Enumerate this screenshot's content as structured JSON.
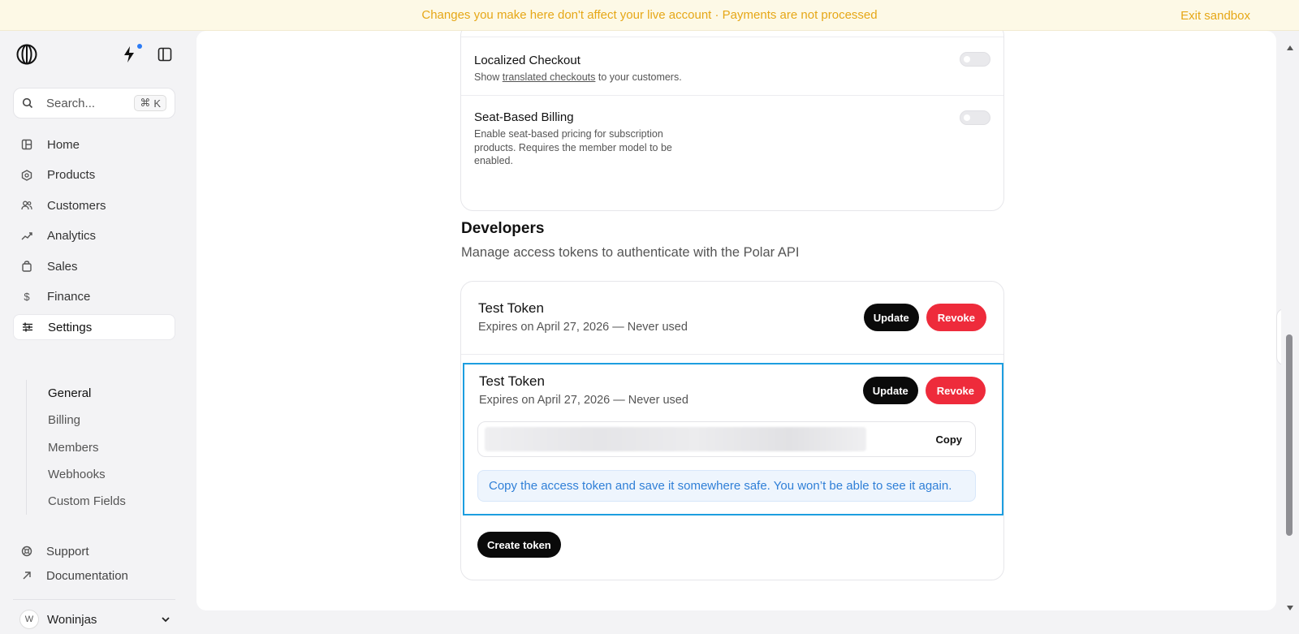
{
  "banner": {
    "message": "Changes you make here don't affect your live account · Payments are not processed",
    "exit_label": "Exit sandbox"
  },
  "sidebar": {
    "search": {
      "placeholder": "Search...",
      "shortcut_symbol": "⌘",
      "shortcut_key": "K"
    },
    "nav": [
      {
        "label": "Home",
        "icon": "home-icon"
      },
      {
        "label": "Products",
        "icon": "products-icon"
      },
      {
        "label": "Customers",
        "icon": "customers-icon"
      },
      {
        "label": "Analytics",
        "icon": "analytics-icon"
      },
      {
        "label": "Sales",
        "icon": "sales-icon"
      },
      {
        "label": "Finance",
        "icon": "finance-icon"
      },
      {
        "label": "Settings",
        "icon": "settings-icon",
        "active": true
      }
    ],
    "settings_subnav": [
      "General",
      "Billing",
      "Members",
      "Webhooks",
      "Custom Fields"
    ],
    "footer_links": [
      {
        "label": "Support",
        "icon": "support-icon"
      },
      {
        "label": "Documentation",
        "icon": "external-link-icon"
      }
    ],
    "user": {
      "initial": "W",
      "name": "Woninjas"
    }
  },
  "features": {
    "localized_checkout": {
      "title": "Localized Checkout",
      "desc_prefix": "Show ",
      "desc_link": "translated checkouts",
      "desc_suffix": " to your customers.",
      "enabled": false
    },
    "seat_based_billing": {
      "title": "Seat-Based Billing",
      "desc": "Enable seat-based pricing for subscription products. Requires the member model to be enabled.",
      "enabled": false
    }
  },
  "developers": {
    "title": "Developers",
    "subtitle": "Manage access tokens to authenticate with the Polar API",
    "tokens": [
      {
        "name": "Test Token",
        "meta": "Expires on April 27, 2026 — Never used",
        "update_label": "Update",
        "revoke_label": "Revoke"
      },
      {
        "name": "Test Token",
        "meta": "Expires on April 27, 2026 — Never used",
        "update_label": "Update",
        "revoke_label": "Revoke",
        "copy_label": "Copy",
        "notice": "Copy the access token and save it somewhere safe. You won’t be able to see it again."
      }
    ],
    "create_label": "Create token"
  },
  "colors": {
    "banner_text": "#e6a717",
    "revoke_red": "#ee2b3b",
    "highlight_blue": "#1d9ee0",
    "notice_text": "#2f7fd7"
  }
}
